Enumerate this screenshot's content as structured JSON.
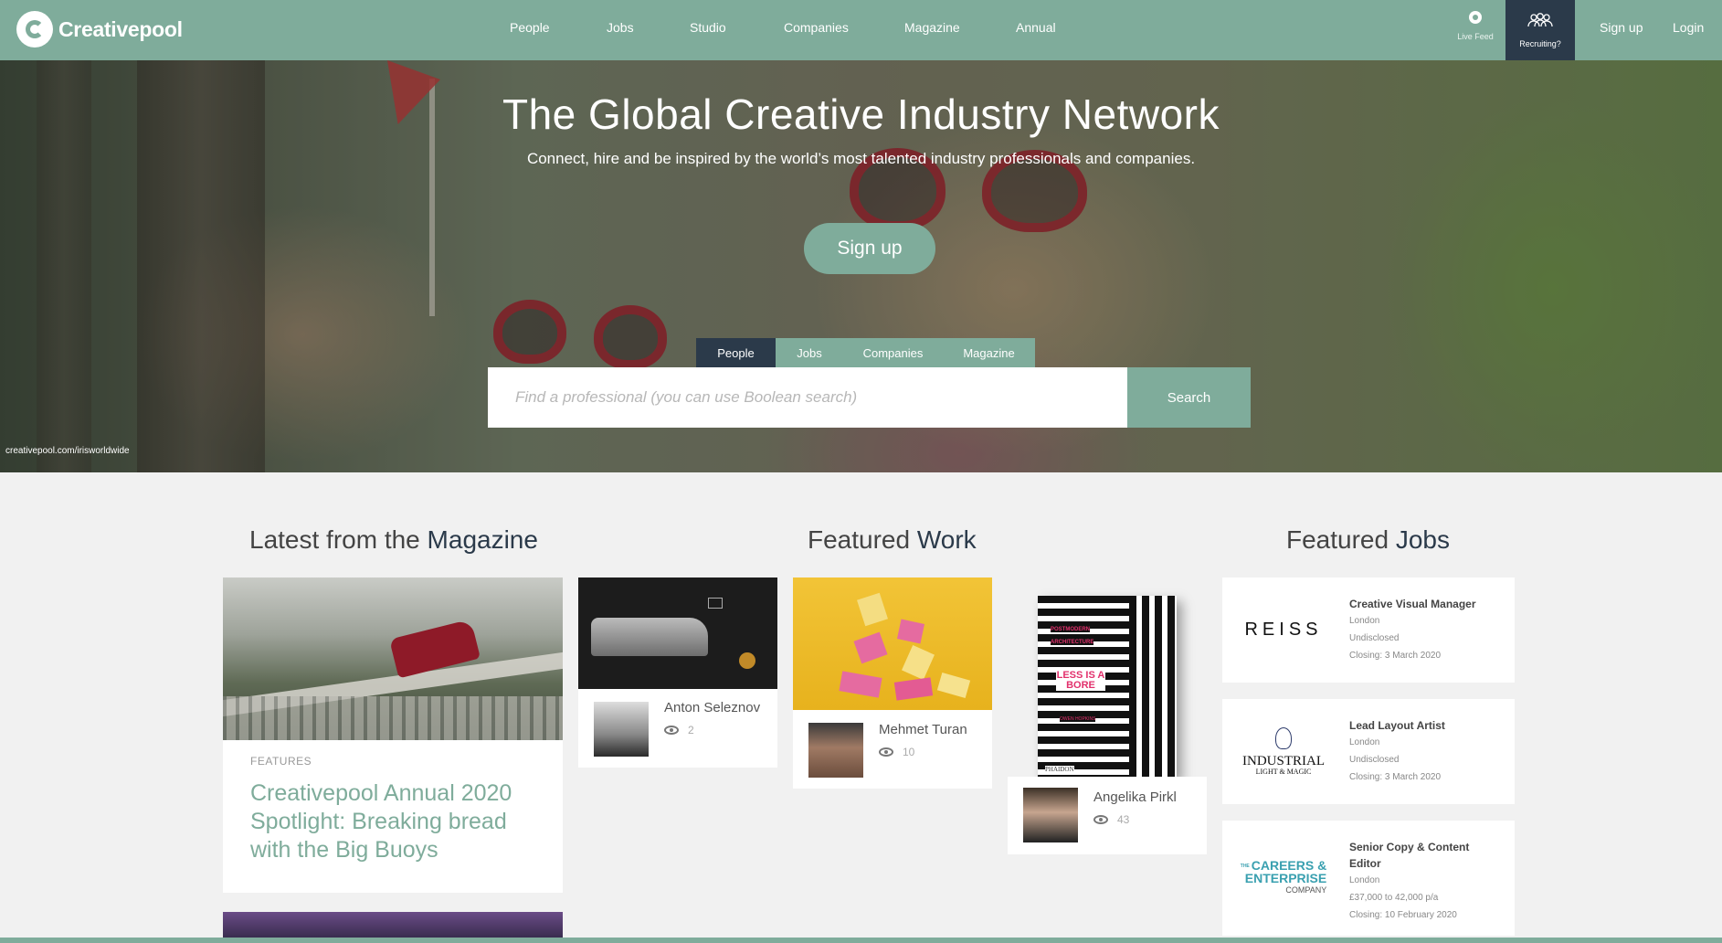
{
  "brand": {
    "name": "Creativepool",
    "accent": "#7fac9b",
    "dark": "#2b3a4a"
  },
  "nav": {
    "items": [
      {
        "label": "People"
      },
      {
        "label": "Jobs"
      },
      {
        "label": "Studio"
      },
      {
        "label": "Companies"
      },
      {
        "label": "Magazine"
      },
      {
        "label": "Annual"
      }
    ],
    "live_feed": "Live Feed",
    "recruiting": "Recruiting?",
    "sign_up": "Sign up",
    "login": "Login"
  },
  "hero": {
    "title": "The Global Creative Industry Network",
    "subtitle": "Connect, hire and be inspired by the world’s most talented industry professionals and companies.",
    "signup_label": "Sign up",
    "credit": "creativepool.com/irisworldwide",
    "search": {
      "tabs": [
        {
          "label": "People",
          "active": true
        },
        {
          "label": "Jobs",
          "active": false
        },
        {
          "label": "Companies",
          "active": false
        },
        {
          "label": "Magazine",
          "active": false
        }
      ],
      "placeholder": "Find a professional (you can use Boolean search)",
      "button": "Search"
    }
  },
  "magazine": {
    "title_light": "Latest from the ",
    "title_bold": "Magazine",
    "feature": {
      "category": "FEATURES",
      "headline": "Creativepool Annual 2020 Spotlight: Breaking bread with the Big Buoys"
    },
    "side_card": {
      "name": "Anton Seleznov",
      "views": "2"
    }
  },
  "featured_work": {
    "title_light": "Featured ",
    "title_bold": "Work",
    "items": [
      {
        "name": "Mehmet Turan",
        "views": "10"
      },
      {
        "name": "Angelika Pirkl",
        "views": "43"
      }
    ],
    "book": {
      "line1": "POSTMODERN",
      "line2": "ARCHITECTURE",
      "title": "LESS IS A BORE",
      "author": "OWEN HOPKINS",
      "publisher": "PHAIDON"
    }
  },
  "featured_jobs": {
    "title_light": "Featured ",
    "title_bold": "Jobs",
    "jobs": [
      {
        "logo": "REISS",
        "title": "Creative Visual Manager",
        "location": "London",
        "salary": "Undisclosed",
        "closing": "Closing: 3 March 2020"
      },
      {
        "logo": "INDUSTRIAL",
        "logo_sub": "LIGHT & MAGIC",
        "title": "Lead Layout Artist",
        "location": "London",
        "salary": "Undisclosed",
        "closing": "Closing: 3 March 2020"
      },
      {
        "logo": "CAREERS &",
        "logo_2": "ENTERPRISE",
        "logo_sub": "COMPANY",
        "logo_the": "THE",
        "title": "Senior Copy & Content Editor",
        "location": "London",
        "salary": "£37,000 to 42,000 p/a",
        "closing": "Closing: 10 February 2020"
      }
    ]
  }
}
